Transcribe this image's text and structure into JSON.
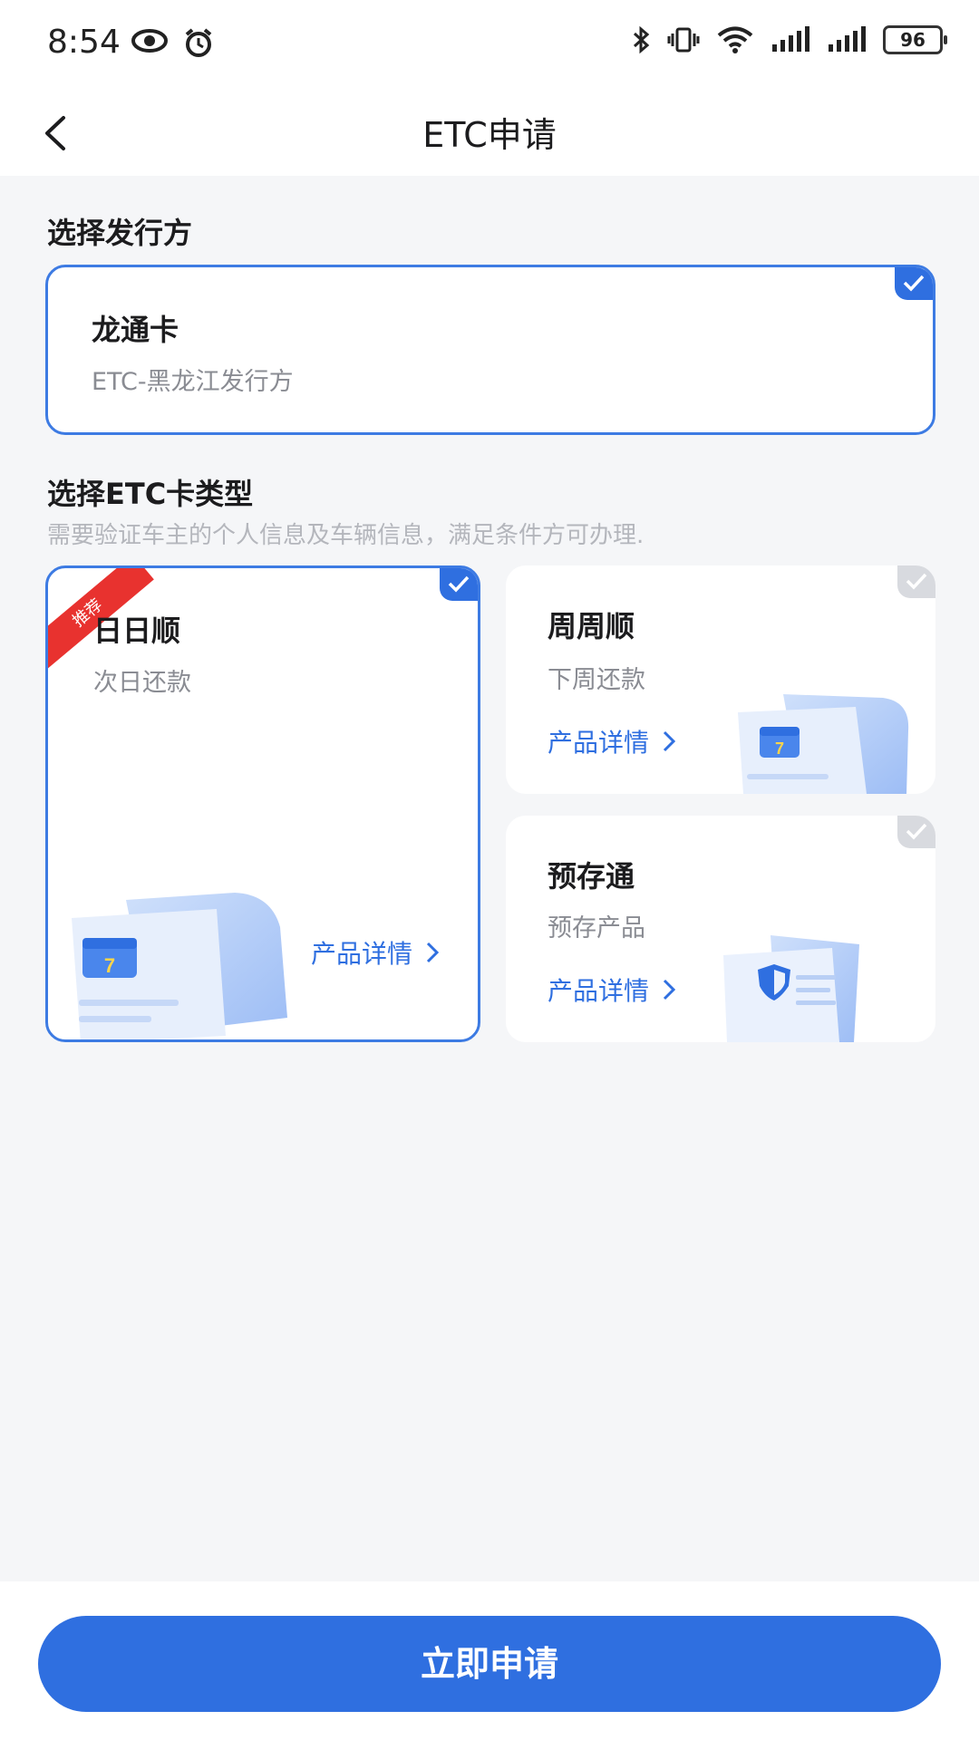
{
  "status": {
    "time": "8:54",
    "battery": "96"
  },
  "nav": {
    "title": "ETC申请"
  },
  "issuer_section": {
    "title": "选择发行方",
    "card": {
      "name": "龙通卡",
      "desc": "ETC-黑龙江发行方",
      "selected": true
    }
  },
  "type_section": {
    "title": "选择ETC卡类型",
    "hint": "需要验证车主的个人信息及车辆信息，满足条件方可办理.",
    "cards": [
      {
        "name": "日日顺",
        "desc": "次日还款",
        "badge": "推荐",
        "link": "产品详情",
        "selected": true
      },
      {
        "name": "周周顺",
        "desc": "下周还款",
        "link": "产品详情",
        "selected": false
      },
      {
        "name": "预存通",
        "desc": "预存产品",
        "link": "产品详情",
        "selected": false
      }
    ]
  },
  "footer": {
    "apply_label": "立即申请"
  },
  "colors": {
    "accent": "#2f6fe0",
    "ribbon": "#e8322f",
    "background": "#f5f6f8"
  }
}
